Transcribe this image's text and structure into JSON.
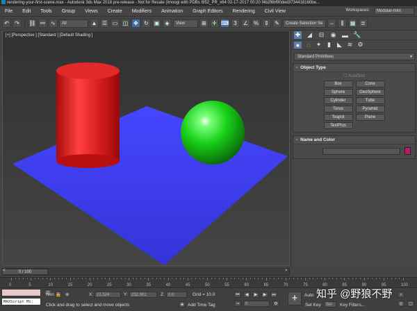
{
  "window": {
    "title": "rendering-your-first-scene.max - Autodesk 3ds Max 2018 pre-release - Not for Resale (Imoogi with PDBs I952_PR_x64 02-17-2017 00:20 f4b2f6bf90ded3734418160be..."
  },
  "menu": {
    "items": [
      "File",
      "Edit",
      "Tools",
      "Group",
      "Views",
      "Create",
      "Modifiers",
      "Animation",
      "Graph Editors",
      "Rendering",
      "Civil View"
    ],
    "workspaces_label": "Workspaces:",
    "workspaces_value": "Modular-mini"
  },
  "toolbar": {
    "filter_value": "All",
    "refcoord_value": "View",
    "selection_set_placeholder": "Create Selection Se"
  },
  "viewport": {
    "label": "[+] [Perspective ] [Standard ] [Default Shading ]",
    "colors": {
      "plane": "#3c3cf0",
      "cylinder": "#d42020",
      "sphere": "#18d018"
    }
  },
  "command_panel": {
    "category_value": "Standard Primitives",
    "object_type": {
      "header": "Object Type",
      "autogrid": "AutoGrid",
      "buttons": [
        "Box",
        "Cone",
        "Sphere",
        "GeoSphere",
        "Cylinder",
        "Tube",
        "Torus",
        "Pyramid",
        "Teapot",
        "Plane",
        "TextPlus"
      ]
    },
    "name_color": {
      "header": "Name and Color",
      "swatch_color": "#c0186a"
    }
  },
  "timeline": {
    "slider_text": "0 / 100",
    "ticks": [
      "0",
      "5",
      "10",
      "15",
      "20",
      "25",
      "30",
      "35",
      "40",
      "45",
      "50",
      "55",
      "60",
      "65",
      "70",
      "75",
      "80",
      "85",
      "90",
      "95",
      "100"
    ]
  },
  "status": {
    "none_label": "Non",
    "x_label": "X:",
    "x_value": "22.524",
    "y_label": "Y:",
    "y_value": "232.301",
    "z_label": "Z:",
    "z_value": "0.0",
    "grid_text": "Grid = 10.0",
    "prompt": "Click and drag to select and move objects",
    "add_time_tag": "Add Time Tag",
    "maxscript_text": "MAXScript Mi:",
    "auto_key": "Auto",
    "set_key": "Set Key",
    "key_filters": "Key Filters...",
    "frame_value": "0",
    "selected_value": "Sel"
  },
  "watermark": "知乎 @野狼不野"
}
